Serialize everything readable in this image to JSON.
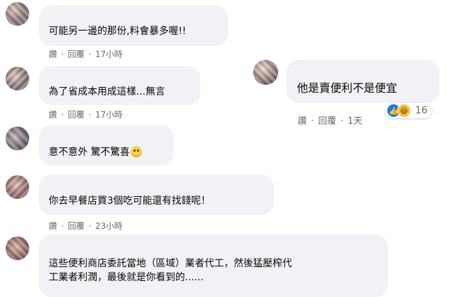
{
  "comments": [
    {
      "text": "可能另一邊的那份,料會暴多喔!!",
      "actions": [
        "讚",
        "回覆"
      ],
      "time": "17小時"
    },
    {
      "text": "為了省成本用成這樣...無言",
      "actions": [
        "讚",
        "回覆"
      ],
      "time": "17小時"
    },
    {
      "text": "意不意外 驚不驚喜",
      "actions": []
    },
    {
      "text": "你去早餐店買3個吃可能還有找錢呢！",
      "actions": [
        "讚",
        "回覆"
      ],
      "time": "23小時"
    },
    {
      "text_lines": [
        "這些便利商店委託當地（區域）業者代工，然後猛壓榨代",
        "工業者利潤，最後就是你看到的......"
      ]
    },
    {
      "text": "他是賣便利不是便宜",
      "actions": [
        "讚",
        "回覆"
      ],
      "time": "1天",
      "reaction_count": "16"
    }
  ],
  "separator": "·",
  "icons": {
    "reaction_like": "like-icon",
    "reaction_haha": "haha-icon",
    "inline_emoji": "grinning-emoji-icon"
  },
  "colors": {
    "bubble": "#f0f2f5",
    "meta": "#65676b",
    "like": "#1877f2"
  }
}
